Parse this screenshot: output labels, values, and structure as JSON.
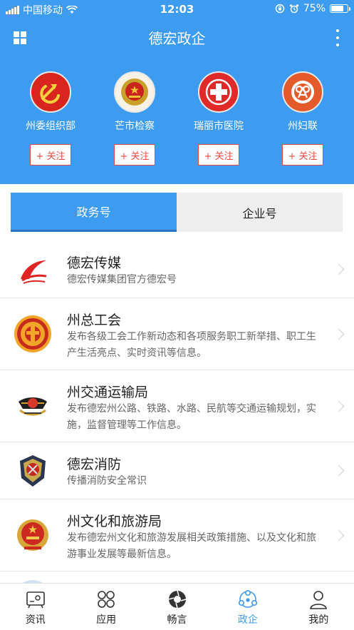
{
  "status_bar": {
    "carrier": "中国移动",
    "time": "12:03",
    "battery": "75%",
    "battery_level": 0.75
  },
  "header": {
    "title": "德宏政企"
  },
  "featured": [
    {
      "name": "州委组织部",
      "follow_label": "+ 关注",
      "logo": "party-emblem"
    },
    {
      "name": "芒市检察",
      "follow_label": "+ 关注",
      "logo": "procuratorate-emblem"
    },
    {
      "name": "瑞丽市医院",
      "follow_label": "+ 关注",
      "logo": "hospital-cross"
    },
    {
      "name": "州妇联",
      "follow_label": "+ 关注",
      "logo": "women-federation-emblem"
    }
  ],
  "tabs": [
    {
      "label": "政务号",
      "active": true
    },
    {
      "label": "企业号",
      "active": false
    }
  ],
  "list": [
    {
      "name": "德宏传媒",
      "desc": "德宏传媒集团官方德宏号",
      "logo": "media-logo"
    },
    {
      "name": "州总工会",
      "desc": "发布各级工会工作新动态和各项服务职工新举措、职工生产生活亮点、实时资讯等信息。",
      "logo": "trade-union-logo"
    },
    {
      "name": "州交通运输局",
      "desc": "发布德宏州公路、铁路、水路、民航等交通运输规划，实施，监督管理等工作信息。",
      "logo": "transport-badge"
    },
    {
      "name": "德宏消防",
      "desc": "传播消防安全常识",
      "logo": "fire-badge"
    },
    {
      "name": "州文化和旅游局",
      "desc": "发布德宏州文化和旅游发展相关政策措施、以及文化和旅游事业发展等最新信息。",
      "logo": "national-emblem"
    }
  ],
  "bottom_nav": [
    {
      "label": "资讯",
      "icon": "news-icon",
      "active": false
    },
    {
      "label": "应用",
      "icon": "apps-icon",
      "active": false
    },
    {
      "label": "畅言",
      "icon": "camera-aperture-icon",
      "active": false
    },
    {
      "label": "政企",
      "icon": "network-icon",
      "active": true
    },
    {
      "label": "我的",
      "icon": "user-icon",
      "active": false
    }
  ],
  "colors": {
    "primary": "#3e9cf0",
    "follow_red": "#e94a3f"
  }
}
